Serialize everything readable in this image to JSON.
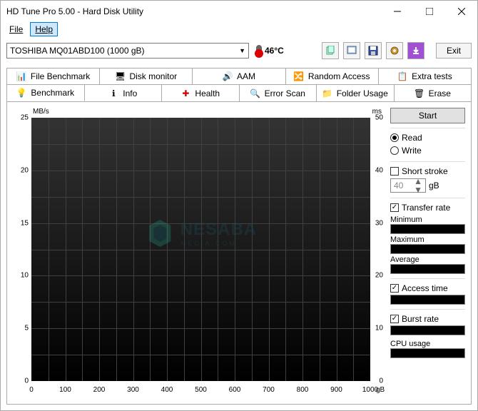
{
  "window": {
    "title": "HD Tune Pro 5.00 - Hard Disk Utility"
  },
  "menubar": {
    "file": "File",
    "help": "Help"
  },
  "toolbar": {
    "drive": "TOSHIBA MQ01ABD100 (1000 gB)",
    "temp": "46°C",
    "exit": "Exit"
  },
  "tabs_row1": {
    "file_benchmark": "File Benchmark",
    "disk_monitor": "Disk monitor",
    "aam": "AAM",
    "random_access": "Random Access",
    "extra_tests": "Extra tests"
  },
  "tabs_row2": {
    "benchmark": "Benchmark",
    "info": "Info",
    "health": "Health",
    "error_scan": "Error Scan",
    "folder_usage": "Folder Usage",
    "erase": "Erase"
  },
  "side": {
    "start": "Start",
    "read": "Read",
    "write": "Write",
    "short_stroke": "Short stroke",
    "short_stroke_value": "40",
    "short_stroke_unit": "gB",
    "transfer_rate": "Transfer rate",
    "minimum": "Minimum",
    "maximum": "Maximum",
    "average": "Average",
    "access_time": "Access time",
    "burst_rate": "Burst rate",
    "cpu_usage": "CPU usage"
  },
  "chart_data": {
    "type": "line",
    "title": "",
    "left_unit": "MB/s",
    "right_unit": "ms",
    "x_unit": "gB",
    "x_ticks": [
      0,
      100,
      200,
      300,
      400,
      500,
      600,
      700,
      800,
      900,
      1000
    ],
    "y_left_ticks": [
      0,
      5,
      10,
      15,
      20,
      25
    ],
    "y_right_ticks": [
      0,
      10,
      20,
      30,
      40,
      50
    ],
    "xlim": [
      0,
      1000
    ],
    "ylim_left": [
      0,
      25
    ],
    "ylim_right": [
      0,
      50
    ],
    "series": []
  },
  "watermark": {
    "brand": "NESABA",
    "subtitle": "MEDIA.COM"
  }
}
